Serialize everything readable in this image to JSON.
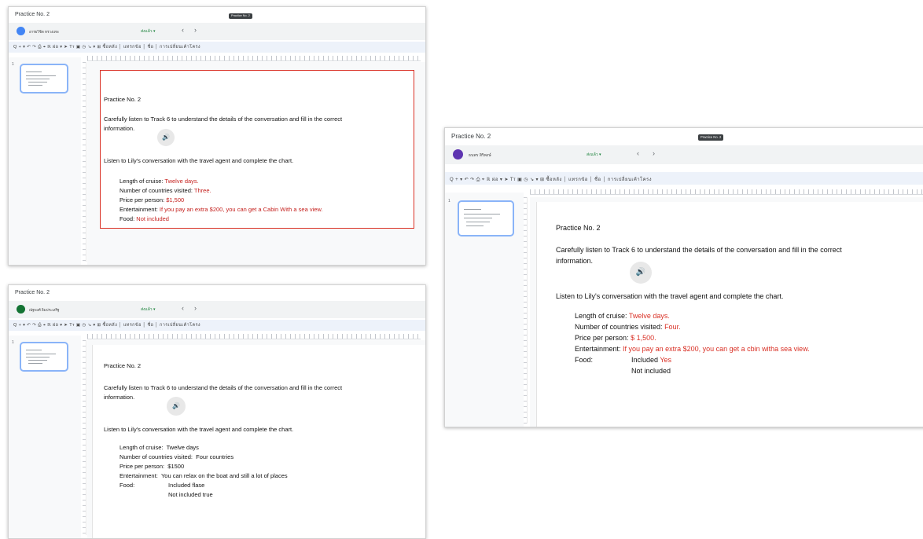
{
  "common": {
    "app_title": "Practice No. 2",
    "send_label": "ส่งแล้ว",
    "dropdown_glyph": "▾",
    "prev_glyph": "‹",
    "next_glyph": "›",
    "page_pill": "Practice No. 2",
    "toolbar_text": "Q  +  ▾  ↶  ↷  ⎙  ⌖  ℝ  ผ่อ  ▾   ➤  Tт  ▣  ◷  ↘  ▾  ⊞   ซื้อหลัง  │ แทรกข้อ  │  ชื่อ  │  การเปลี่ยนเค้าโครง",
    "slide_num": "1",
    "speaker_glyph": "🔊",
    "doc_title": "Practice No. 2",
    "instruction_1": "Carefully listen to Track 6 to understand the details of the conversation and fill in the correct",
    "instruction_2": "information.",
    "instruction_3": "Listen to Lily's conversation with the travel agent and complete the chart.",
    "labels": {
      "length": "Length of cruise:",
      "countries": "Number of countries visited:",
      "price": "Price per person:",
      "entertainment": "Entertainment:",
      "food": "Food:"
    }
  },
  "win1": {
    "user_name": "อารยวิชิต ทรวงเทพ",
    "answers": {
      "length": "Twelve days.",
      "countries": "Three.",
      "price": "$1,500",
      "entertainment": "If you pay an extra $200, you can get a Cabin With a sea view.",
      "food": "Not included"
    }
  },
  "win2": {
    "user_name": "ณัฐพงศ์ ลิมประเสริฐ",
    "answers": {
      "length": "Twelve days",
      "countries": "Four countries",
      "price": "$1500",
      "entertainment": "You can relax on the boat and still a lot of places",
      "food_line1": "Included  flase",
      "food_line2": "Not included true"
    }
  },
  "win3": {
    "user_name": "ธนพร สิริพงษ์",
    "answers": {
      "length": "Twelve days.",
      "countries": "Four.",
      "price": "$ 1,500.",
      "entertainment": "If you pay an extra $200, you can get a cbin witha sea view.",
      "food_included": "Included",
      "food_yes": "Yes",
      "food_not": "Not included"
    }
  },
  "colors": {
    "answer_red": "#d93025",
    "answer_darkred": "#c5221f",
    "avatar_blue": "#4285f4",
    "avatar_teal": "#137333",
    "avatar_purple": "#5e35b1",
    "send_green": "#188038"
  }
}
